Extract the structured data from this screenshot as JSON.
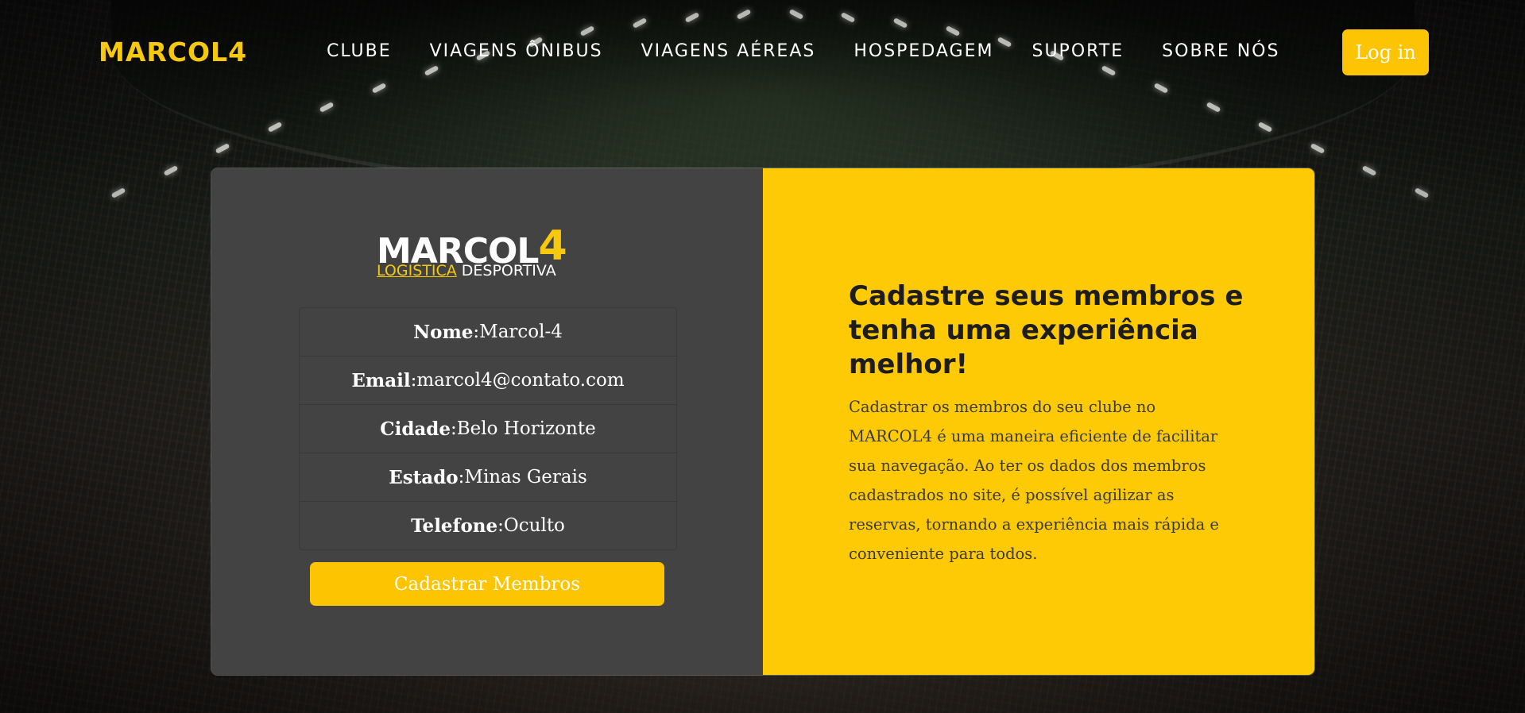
{
  "nav": {
    "brand": "MARCOL4",
    "links": [
      "CLUBE",
      "VIAGENS ÔNIBUS",
      "VIAGENS AÉREAS",
      "HOSPEDAGEM",
      "SUPORTE",
      "SOBRE NÓS"
    ],
    "login_label": "Log in"
  },
  "logo": {
    "main": "MARCOL",
    "digit": "4",
    "sub_a": "LOGISTICA",
    "sub_b": " DESPORTIVA"
  },
  "profile": {
    "rows": [
      {
        "key": "Nome",
        "value": " Marcol-4"
      },
      {
        "key": "Email",
        "value": " marcol4@contato.com"
      },
      {
        "key": "Cidade",
        "value": " Belo Horizonte"
      },
      {
        "key": "Estado",
        "value": " Minas Gerais"
      },
      {
        "key": "Telefone",
        "value": " Oculto"
      }
    ],
    "cta_label": "Cadastrar Membros"
  },
  "promo": {
    "title": "Cadastre seus membros e tenha uma experiência melhor!",
    "text": "Cadastrar os membros do seu clube no MARCOL4 é uma maneira eficiente de facilitar sua navegação. Ao ter os dados dos membros cadastrados no site, é possível agilizar as reservas, tornando a experiência mais rápida e conveniente para todos."
  },
  "colors": {
    "accent": "#fec905",
    "panel": "#434343"
  }
}
